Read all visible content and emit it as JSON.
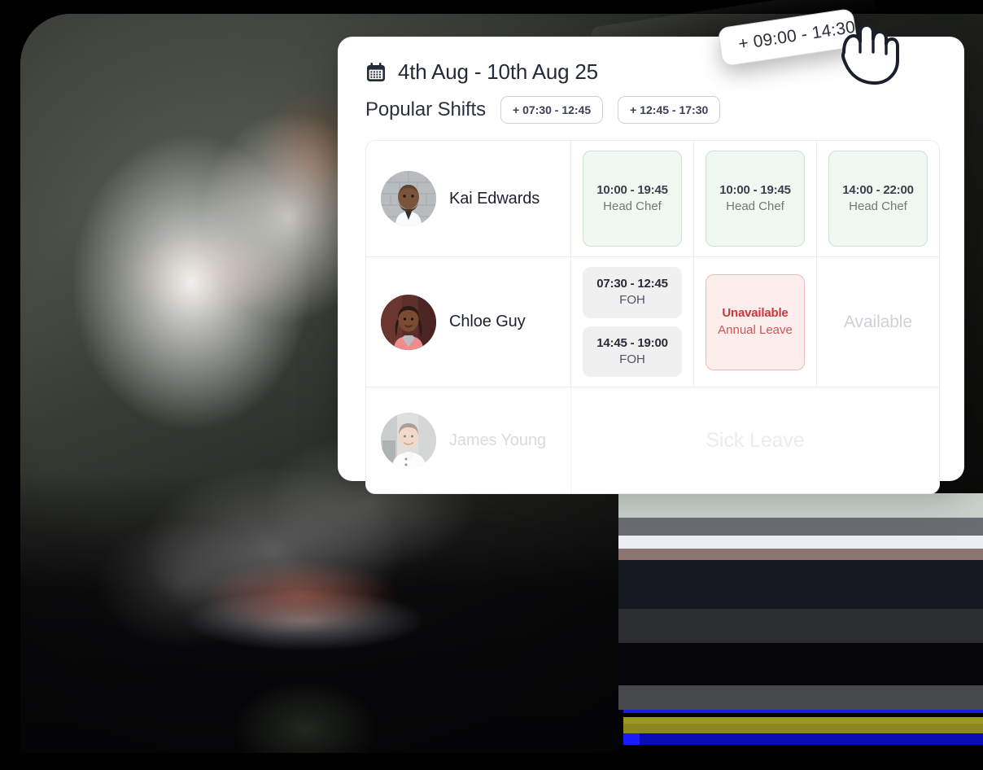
{
  "header": {
    "calendar_icon": "calendar-icon",
    "date_range": "4th Aug - 10th Aug 25"
  },
  "popular_shifts": {
    "label": "Popular Shifts",
    "pills": [
      {
        "label": "+ 07:30 - 12:45"
      },
      {
        "label": "+ 12:45 - 17:30"
      }
    ]
  },
  "drag_chip": {
    "label": "+ 09:00 - 14:30",
    "cursor_icon": "grabbing-hand-cursor"
  },
  "schedule": {
    "rows": [
      {
        "name": "Kai Edwards",
        "avatar": "avatar-kai-edwards",
        "cells": [
          {
            "kind": "shift",
            "style": "green",
            "time": "10:00 - 19:45",
            "role": "Head Chef"
          },
          {
            "kind": "shift",
            "style": "green",
            "time": "10:00 - 19:45",
            "role": "Head Chef"
          },
          {
            "kind": "shift",
            "style": "green",
            "time": "14:00 - 22:00",
            "role": "Head Chef"
          }
        ]
      },
      {
        "name": "Chloe Guy",
        "avatar": "avatar-chloe-guy",
        "cells": [
          {
            "kind": "multi",
            "blocks": [
              {
                "style": "grey",
                "time": "07:30 - 12:45",
                "role": "FOH"
              },
              {
                "style": "grey",
                "time": "14:45 - 19:00",
                "role": "FOH"
              }
            ]
          },
          {
            "kind": "shift",
            "style": "red",
            "time": "Unavailable",
            "role": "Annual Leave"
          },
          {
            "kind": "placeholder",
            "text": "Available"
          }
        ]
      },
      {
        "name": "James Young",
        "avatar": "avatar-james-young",
        "muted": true,
        "merged": {
          "text": "Sick Leave"
        }
      }
    ]
  },
  "colors": {
    "accent_green_bg": "#f0f8f1",
    "accent_green_border": "#cfe3d2",
    "accent_red_bg": "#fdeeee",
    "accent_red_text": "#c8383c",
    "neutral_chip_bg": "#f0f0f1",
    "text_primary": "#242a38",
    "text_muted": "#cfd1d4"
  }
}
